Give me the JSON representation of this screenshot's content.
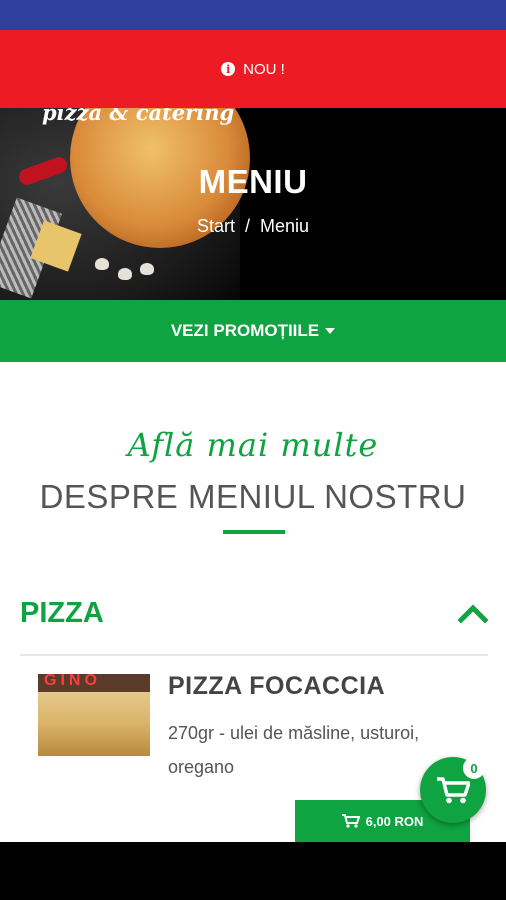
{
  "notice": {
    "text": "NOU !",
    "icon": "info-icon"
  },
  "hero": {
    "brand": "pizza & catering",
    "title": "MENIU",
    "breadcrumb": {
      "home": "Start",
      "separator": "/",
      "current": "Meniu"
    }
  },
  "promo": {
    "label": "VEZI PROMOȚIILE"
  },
  "intro": {
    "script": "Află mai multe",
    "heading": "DESPRE MENIUL NOSTRU"
  },
  "category": {
    "name": "PIZZA",
    "state_icon": "chevron-up-icon"
  },
  "item": {
    "image_sign": "GINO",
    "name": "PIZZA FOCACCIA",
    "description": "270gr - ulei de măsline, usturoi, oregano",
    "price": "6,00 RON"
  },
  "cart": {
    "count": "0"
  },
  "colors": {
    "green": "#0fa341",
    "red": "#ed1c24",
    "status_blue": "#2e3f9e"
  }
}
